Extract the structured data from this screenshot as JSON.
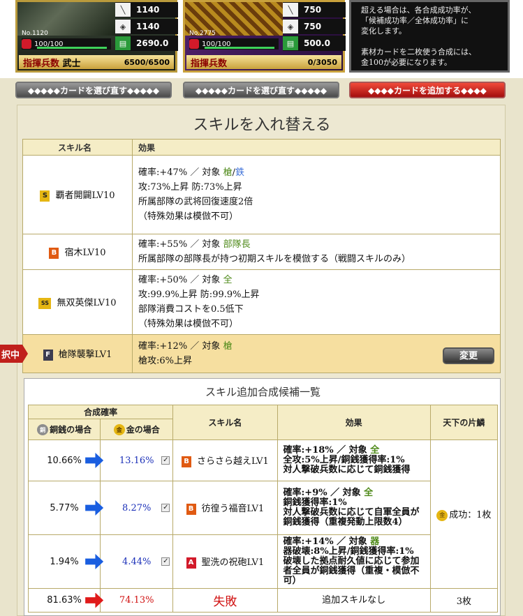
{
  "cards": [
    {
      "no": "No.1120",
      "atk": "1140",
      "def": "1140",
      "int": "2690.0",
      "hp": "100/100",
      "cmd_label": "指揮兵数",
      "cmd_type": "武士",
      "cmd_value": "6500/6500",
      "hp_fill": 1.0
    },
    {
      "no": "No.2775",
      "atk": "750",
      "def": "750",
      "int": "500.0",
      "hp": "100/100",
      "cmd_label": "指揮兵数",
      "cmd_type": "",
      "cmd_value": "0/3050",
      "hp_fill": 1.0
    }
  ],
  "info": [
    "超える場合は、各合成成功率が、",
    "「候補成功率／全体成功率」に",
    "変化します。",
    "",
    "素材カードを二枚使う合成には、",
    "金100が必要になります。"
  ],
  "buttons": {
    "reselect1": "◆◆◆◆◆カードを選び直す◆◆◆◆◆",
    "reselect2": "◆◆◆◆◆カードを選び直す◆◆◆◆◆",
    "add": "◆◆◆◆カードを追加する◆◆◆◆"
  },
  "panel_title": "スキルを入れ替える",
  "skills_header": {
    "name": "スキル名",
    "effect": "効果"
  },
  "skills": [
    {
      "rank": "S",
      "name": "覇者開闢LV10",
      "lines": [
        [
          "確率:+47% ／ 対象 ",
          "槍",
          "/",
          "鉄"
        ],
        "攻:73%上昇 防:73%上昇",
        "所属部隊の武将回復速度2倍",
        "（特殊効果は模倣不可）"
      ]
    },
    {
      "rank": "B",
      "name": "宿木LV10",
      "lines": [
        [
          "確率:+55% ／ 対象 ",
          "部隊長"
        ],
        "所属部隊の部隊長が持つ初期スキルを模倣する（戦闘スキルのみ）"
      ]
    },
    {
      "rank": "SS",
      "name": "無双英傑LV10",
      "lines": [
        [
          "確率:+50% ／ 対象 ",
          "全"
        ],
        "攻:99.9%上昇 防:99.9%上昇",
        "部隊消費コストを0.5低下",
        "（特殊効果は模倣不可）"
      ]
    },
    {
      "rank": "F",
      "name": "槍隊襲撃LV1",
      "lines": [
        [
          "確率:+12% ／ 対象 ",
          "槍"
        ],
        "槍攻:6%上昇"
      ]
    }
  ],
  "change_button": "変更",
  "selected_tab": "択中",
  "candidates_title": "スキル追加合成候補一覧",
  "cand_header": {
    "rate": "合成確率",
    "copper": "銅銭の場合",
    "gold": "金の場合",
    "skill": "スキル名",
    "effect": "効果",
    "tenka": "天下の片鱗"
  },
  "candidates": [
    {
      "copper": "10.66%",
      "gold": "13.16%",
      "rank": "B",
      "name": "さらさら越えLV1",
      "effect": [
        [
          "確率:+18% ／ 対象 ",
          "全"
        ],
        "全攻:5%上昇/銅銭獲得率:1%",
        "対人撃破兵数に応じて銅銭獲得"
      ]
    },
    {
      "copper": "5.77%",
      "gold": "8.27%",
      "rank": "B",
      "name": "彷徨う福音LV1",
      "effect": [
        [
          "確率:+9% ／ 対象 ",
          "全"
        ],
        "銅銭獲得率:1%",
        "対人撃破兵数に応じて自軍全員が",
        "銅銭獲得（重複発動上限数4）"
      ]
    },
    {
      "copper": "1.94%",
      "gold": "4.44%",
      "rank": "A",
      "name": "聖洗の祝砲LV1",
      "effect": [
        [
          "確率:+14% ／ 対象 ",
          "器"
        ],
        "器破壊:8%上昇/銅銭獲得率:1%",
        "破壊した拠点耐久値に応じて参加",
        "者全員が銅銭獲得（重複・模倣不可）"
      ]
    }
  ],
  "tenka_success": "成功：1枚",
  "fail_row": {
    "copper": "81.63%",
    "gold": "74.13%",
    "name": "失敗",
    "effect": "追加スキルなし",
    "tenka": "3枚"
  }
}
